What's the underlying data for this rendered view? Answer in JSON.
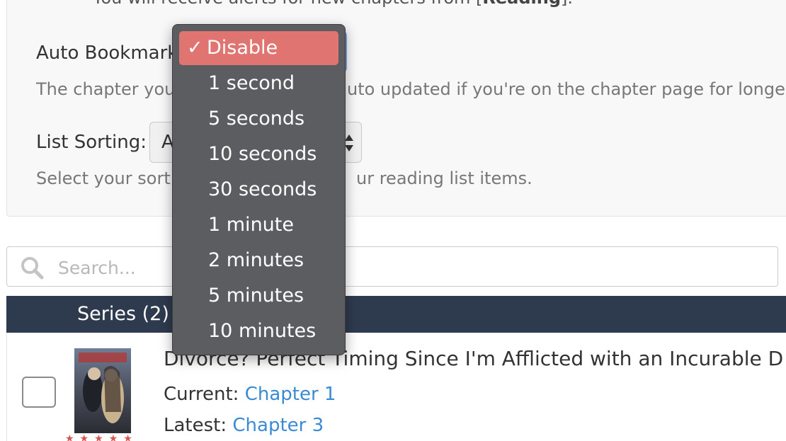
{
  "settings": {
    "alert_text_prefix": "You will receive alerts for new chapters from [",
    "alert_text_bold": "Reading",
    "alert_text_suffix": "].",
    "auto_bookmark_label": "Auto Bookmark",
    "auto_bookmark_help_left": "The chapter you",
    "auto_bookmark_help_right": "uto updated if you're on the chapter page for longer",
    "list_sorting_label": "List Sorting:",
    "list_sorting_value": "A",
    "list_sorting_help_left": "Select your sorti",
    "list_sorting_help_right": "ur reading list items."
  },
  "dropdown": {
    "checkmark": "✓",
    "options": [
      "Disable",
      "1 second",
      "5 seconds",
      "10 seconds",
      "30 seconds",
      "1 minute",
      "2 minutes",
      "5 minutes",
      "10 minutes"
    ],
    "selected": "Disable"
  },
  "search": {
    "placeholder": "Search..."
  },
  "series": {
    "header": "Series (2)",
    "items": [
      {
        "title": "Divorce? Perfect Timing Since I'm Afflicted with an Incurable D",
        "current_label": "Current:",
        "current_link": "Chapter 1",
        "latest_label": "Latest:",
        "latest_link": "Chapter 3",
        "rating_stars": "★★★★★"
      }
    ]
  },
  "colors": {
    "selected_option_bg": "#e07470",
    "menu_bg": "#5c5d60",
    "header_bg": "#2e3a4e",
    "link": "#3a8ad4",
    "focus_border": "#7aa7e8"
  }
}
